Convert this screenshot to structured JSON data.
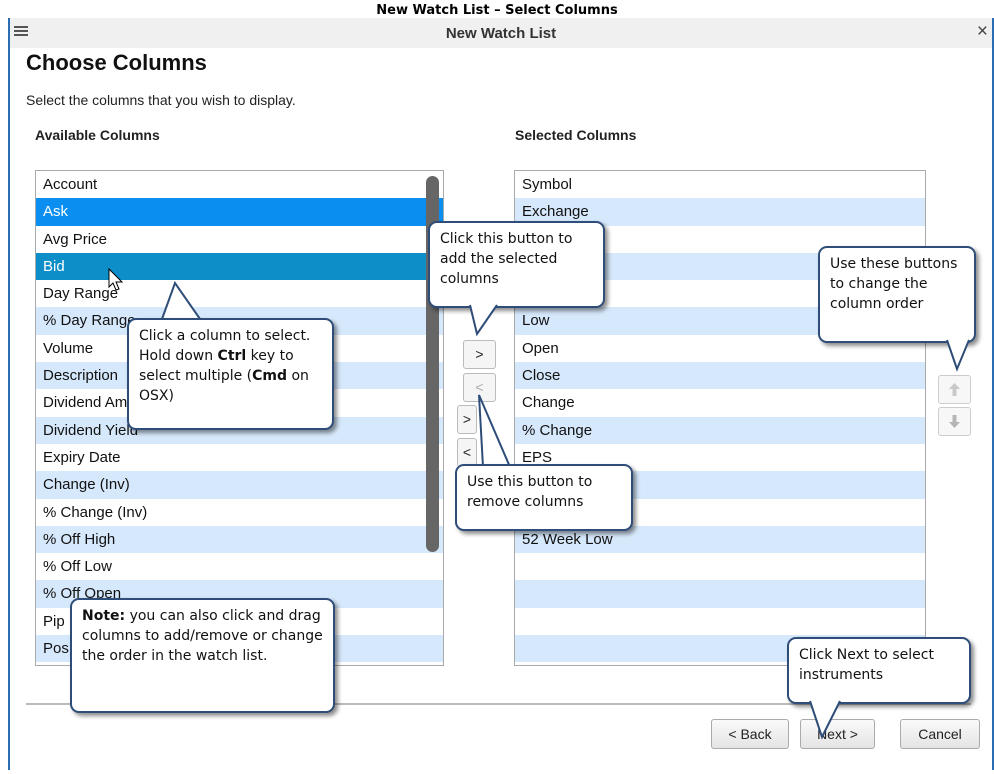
{
  "document_title": "New Watch List – Select Columns",
  "window": {
    "title": "New Watch List",
    "close_glyph": "×",
    "menu_icon": "hamburger-icon"
  },
  "heading": "Choose Columns",
  "instruction": "Select the columns that you wish to display.",
  "available": {
    "header": "Available Columns",
    "items": [
      "Account",
      "Ask",
      "Avg Price",
      "Bid",
      "Day Range",
      "% Day Range",
      "Volume",
      "Description",
      "Dividend Amount",
      "Dividend Yield",
      "Expiry Date",
      "Change (Inv)",
      "% Change (Inv)",
      "% Off High",
      "% Off Low",
      "% Off Open",
      "Pip",
      "Pos"
    ]
  },
  "selected": {
    "header": "Selected Columns",
    "items": [
      "Symbol",
      "Exchange",
      "",
      "",
      "",
      "Low",
      "Open",
      "Close",
      "Change",
      "% Change",
      "EPS",
      "",
      "",
      "52 Week Low",
      "",
      "",
      "",
      "",
      ""
    ]
  },
  "move_buttons": {
    "add": ">",
    "remove": "<",
    "add_all": ">",
    "remove_all": "<"
  },
  "order_buttons": {
    "up": "up-arrow-icon",
    "down": "down-arrow-icon"
  },
  "footer": {
    "back": "< Back",
    "next": "Next >",
    "cancel": "Cancel"
  },
  "callouts": {
    "add": "Click this button to add the selected columns",
    "order": "Use these buttons to change the column order",
    "select": {
      "p1": "Click a column to select.  Hold down ",
      "k1": "Ctrl",
      "p2": " key to select multiple (",
      "k2": "Cmd",
      "p3": " on OSX)"
    },
    "remove": "Use this button to remove columns",
    "note": {
      "label": "Note:",
      "text": " you can also click and drag columns to add/remove or change the order in the watch list."
    },
    "next": "Click Next to select instruments"
  }
}
